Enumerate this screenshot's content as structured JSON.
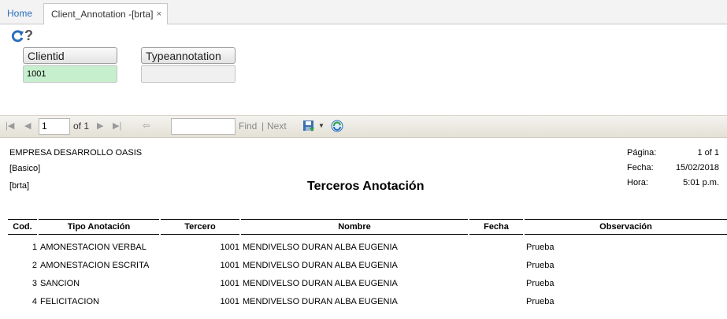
{
  "tabs": {
    "home": "Home",
    "active": "Client_Annotation -[brta]",
    "close": "×"
  },
  "form": {
    "fields": [
      {
        "label": "Clientid",
        "value": "1001",
        "bg": "#c6efce"
      },
      {
        "label": "Typeannotation",
        "value": "",
        "bg": "#f0f0f0"
      }
    ]
  },
  "toolbar": {
    "page": "1",
    "of": "of 1",
    "find": "Find",
    "separator": "|",
    "next": "Next"
  },
  "report": {
    "company": "EMPRESA DESARROLLO OASIS",
    "line2": "[Basico]",
    "line3": "[brta]",
    "title": "Terceros Anotación",
    "meta": [
      {
        "label": "Página:",
        "value": "1 of 1"
      },
      {
        "label": "Fecha:",
        "value": "15/02/2018"
      },
      {
        "label": "Hora:",
        "value": "5:01 p.m."
      }
    ],
    "columns": [
      "Cod.",
      "Tipo Anotación",
      "Tercero",
      "Nombre",
      "Fecha",
      "Observación"
    ],
    "rows": [
      {
        "cod": "1",
        "tipo": "AMONESTACION VERBAL",
        "tercero": "1001",
        "nombre": "MENDIVELSO DURAN ALBA EUGENIA",
        "fecha": "",
        "obs": "Prueba"
      },
      {
        "cod": "2",
        "tipo": "AMONESTACION ESCRITA",
        "tercero": "1001",
        "nombre": "MENDIVELSO DURAN ALBA EUGENIA",
        "fecha": "",
        "obs": "Prueba"
      },
      {
        "cod": "3",
        "tipo": "SANCION",
        "tercero": "1001",
        "nombre": "MENDIVELSO DURAN ALBA EUGENIA",
        "fecha": "",
        "obs": "Prueba"
      },
      {
        "cod": "4",
        "tipo": "FELICITACION",
        "tercero": "1001",
        "nombre": "MENDIVELSO DURAN ALBA EUGENIA",
        "fecha": "",
        "obs": "Prueba"
      }
    ]
  }
}
